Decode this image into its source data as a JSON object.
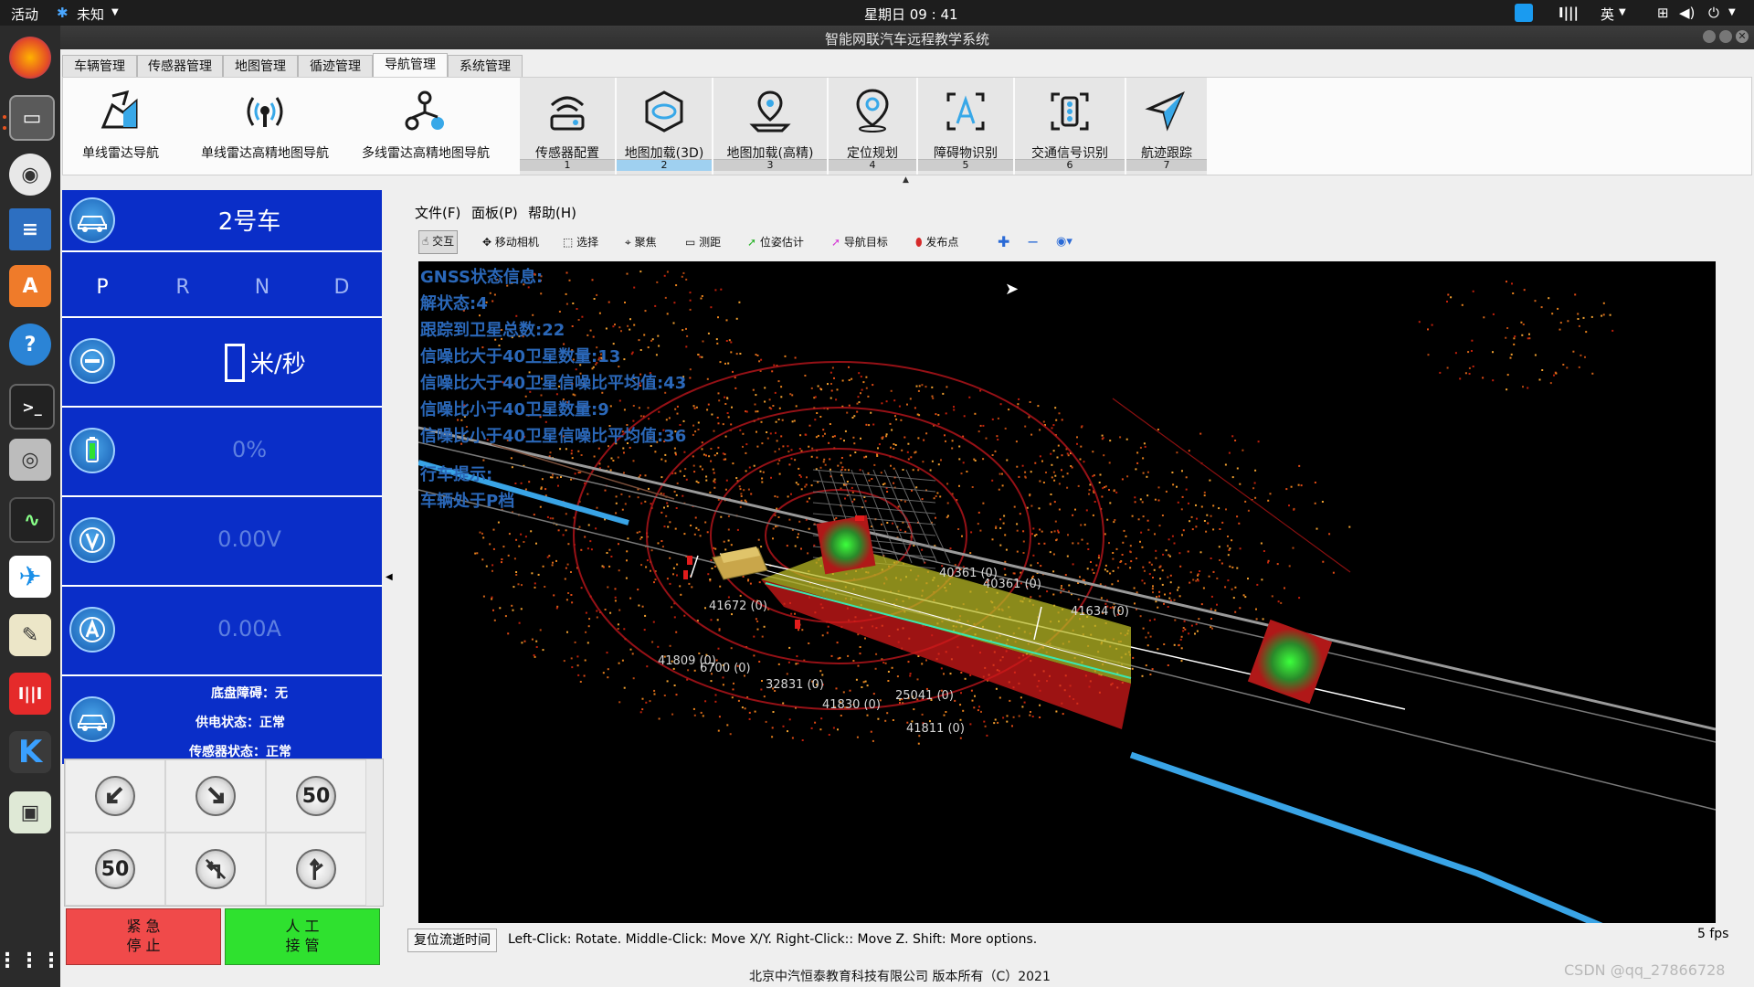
{
  "topbar": {
    "activities": "活动",
    "app_menu": "未知",
    "clock": "星期日 09 : 41",
    "input_method": "英"
  },
  "window": {
    "title": "智能网联汽车远程教学系统"
  },
  "tabs": [
    {
      "label": "车辆管理"
    },
    {
      "label": "传感器管理"
    },
    {
      "label": "地图管理"
    },
    {
      "label": "循迹管理"
    },
    {
      "label": "导航管理",
      "active": true
    },
    {
      "label": "系统管理"
    }
  ],
  "ribbon": {
    "left_buttons": [
      {
        "label": "单线雷达导航",
        "icon": "lidar-map-icon"
      },
      {
        "label": "单线雷达高精地图导航",
        "icon": "radar-signal-icon"
      },
      {
        "label": "多线雷达高精地图导航",
        "icon": "multi-node-icon"
      }
    ],
    "step_buttons": [
      {
        "label": "传感器配置",
        "num": "1",
        "icon": "sensor-config-icon"
      },
      {
        "label": "地图加载(3D)",
        "num": "2",
        "icon": "map-3d-icon",
        "selected": true
      },
      {
        "label": "地图加载(高精)",
        "num": "3",
        "icon": "map-hd-icon"
      },
      {
        "label": "定位规划",
        "num": "4",
        "icon": "location-pin-icon"
      },
      {
        "label": "障碍物识别",
        "num": "5",
        "icon": "obstacle-icon"
      },
      {
        "label": "交通信号识别",
        "num": "6",
        "icon": "traffic-light-icon"
      },
      {
        "label": "航迹跟踪",
        "num": "7",
        "icon": "navigation-arrow-icon"
      }
    ]
  },
  "vehicle": {
    "name": "2号车",
    "gears": [
      "P",
      "R",
      "N",
      "D"
    ],
    "active_gear": "P",
    "speed_value": "",
    "speed_unit": "米/秒",
    "battery": "0%",
    "voltage": "0.00V",
    "current": "0.00A",
    "status_lines": [
      "底盘障碍：无",
      "供电状态：正常",
      "传感器状态：正常"
    ]
  },
  "signs": [
    "turn-left-down-icon",
    "turn-right-down-icon",
    "50",
    "50",
    "no-left-turn-icon",
    "straight-or-right-icon"
  ],
  "buttons": {
    "estop_line1": "紧 急",
    "estop_line2": "停 止",
    "manual_line1": "人 工",
    "manual_line2": "接 管"
  },
  "rviz": {
    "menu": [
      "文件(F)",
      "面板(P)",
      "帮助(H)"
    ],
    "tools": [
      {
        "label": "交互",
        "icon": "hand-icon",
        "active": true
      },
      {
        "label": "移动相机",
        "icon": "move-camera-icon"
      },
      {
        "label": "选择",
        "icon": "select-box-icon"
      },
      {
        "label": "聚焦",
        "icon": "focus-icon"
      },
      {
        "label": "测距",
        "icon": "ruler-icon"
      },
      {
        "label": "位姿估计",
        "icon": "pose-estimate-icon"
      },
      {
        "label": "导航目标",
        "icon": "nav-goal-icon"
      },
      {
        "label": "发布点",
        "icon": "publish-point-icon"
      }
    ],
    "gnss": [
      "GNSS状态信息:",
      "解状态:4",
      "跟踪到卫星总数:22",
      "信噪比大于40卫星数量:13",
      "信噪比大于40卫星信噪比平均值:43",
      "信噪比小于40卫星数量:9",
      "信噪比小于40卫星信噪比平均值:36"
    ],
    "drive_hint_title": "行车提示:",
    "drive_hint": "车辆处于P档",
    "labels": [
      "40361 (0)",
      "40361 (0)",
      "41672 (0)",
      "41634 (0)",
      "41809 (0)",
      "6700 (0)",
      "32831 (0)",
      "25041 (0)",
      "41830 (0)",
      "41811 (0)"
    ],
    "reset_button": "复位流逝时间",
    "help_text": "Left-Click: Rotate. Middle-Click: Move X/Y. Right-Click:: Move Z. Shift: More options.",
    "fps": "5 fps"
  },
  "footer": "北京中汽恒泰教育科技有限公司 版本所有（C）2021",
  "watermark": "CSDN @qq_27866728",
  "colors": {
    "panel_blue": "#0a2ec8",
    "gnss_text": "#2a67b8",
    "estop": "#f04a4a",
    "manual": "#2fe12f"
  }
}
